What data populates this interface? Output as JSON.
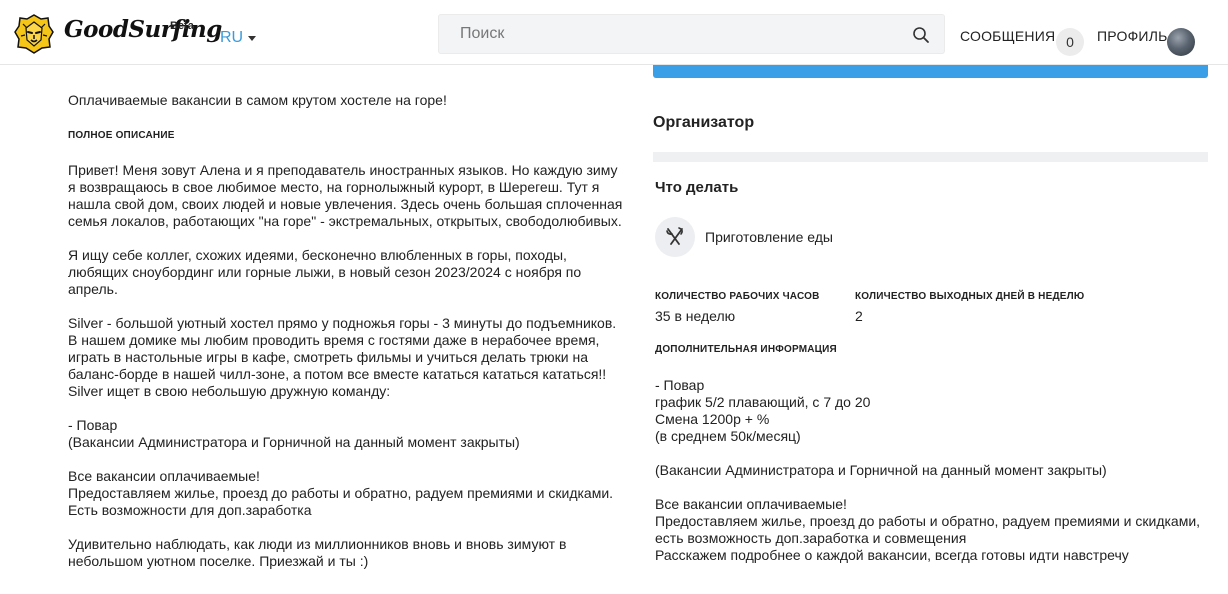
{
  "header": {
    "logo_text": "GoodSurfing",
    "logo_badge": "Beta",
    "language": "RU",
    "search_placeholder": "Поиск",
    "messages_label": "СООБЩЕНИЯ",
    "messages_count": "0",
    "profile_label": "ПРОФИЛЬ"
  },
  "left": {
    "short_description": "Оплачиваемые вакансии в самом крутом хостеле на горе!",
    "full_description_label": "ПОЛНОЕ ОПИСАНИЕ",
    "full_description": "Привет! Меня зовут Алена и я преподаватель иностранных языков. Но каждую зиму\nя возвращаюсь в свое любимое место, на горнолыжный курорт, в Шерегеш. Тут я\nнашла свой дом, своих людей и новые увлечения. Здесь очень большая сплоченная\nсемья локалов, работающих \"на горе\" - экстремальных, открытых, свободолюбивых.\n\nЯ ищу себе коллег, схожих идеями, бесконечно влюбленных в горы, походы,\nлюбящих сноубординг или горные лыжи, в новый сезон 2023/2024 с ноября по\nапрель.\n\nSilver - большой уютный хостел прямо у подножья горы - 3 минуты до подъемников.\nВ нашем домике мы любим проводить время с гостями даже в нерабочее время,\nиграть в настольные игры в кафе, смотреть фильмы и учиться делать трюки на\nбаланс-борде в нашей чилл-зоне, а потом все вместе кататься кататься кататься!!\nSilver ищет в свою небольшую дружную команду:\n\n- Повар\n(Вакансии Администратора и Горничной на данный момент закрыты)\n\nВсе вакансии оплачиваемые!\nПредоставляем жилье, проезд до работы и обратно, радуем премиями и скидками.\nЕсть возможности для доп.заработка\n\nУдивительно наблюдать, как люди из миллионников вновь и вновь зимуют в\nнебольшом уютном поселке. Приезжай и ты :)"
  },
  "right": {
    "organizer_title": "Организатор",
    "todo_title": "Что делать",
    "task": {
      "icon": "fork-knife-icon",
      "label": "Приготовление еды"
    },
    "hours_label": "КОЛИЧЕСТВО РАБОЧИХ ЧАСОВ",
    "hours_value": "35 в неделю",
    "days_off_label": "КОЛИЧЕСТВО ВЫХОДНЫХ ДНЕЙ В НЕДЕЛЮ",
    "days_off_value": "2",
    "extra_label": "ДОПОЛНИТЕЛЬНАЯ ИНФОРМАЦИЯ",
    "extra_text": "- Повар\nграфик 5/2 плавающий, с 7 до 20\nСмена 1200р + %\n(в среднем 50к/месяц)\n\n(Вакансии Администратора и Горничной на данный момент закрыты)\n\nВсе вакансии оплачиваемые!\nПредоставляем жилье, проезд до работы и обратно, радуем премиями и скидками,\nесть возможность доп.заработка и совмещения\nРасскажем подробнее о каждой вакансии, всегда готовы идти навстречу"
  },
  "colors": {
    "accent": "#3a9fe6",
    "language_link": "#3a9bdc",
    "logo_yellow": "#f5c518"
  }
}
